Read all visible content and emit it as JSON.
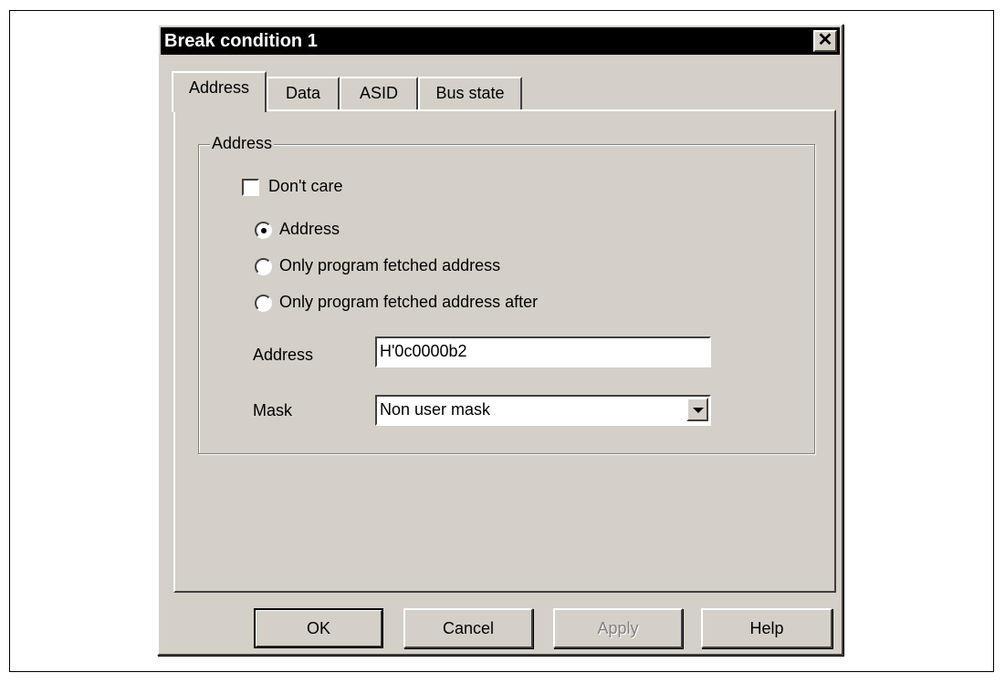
{
  "dialog": {
    "title": "Break condition 1",
    "close_glyph": "✕"
  },
  "tabs": [
    {
      "label": "Address"
    },
    {
      "label": "Data"
    },
    {
      "label": "ASID"
    },
    {
      "label": "Bus state"
    }
  ],
  "address_group": {
    "legend": "Address",
    "dont_care": {
      "label": "Don't care",
      "checked": false
    },
    "radios": [
      {
        "label": "Address",
        "selected": true
      },
      {
        "label": "Only program fetched address",
        "selected": false
      },
      {
        "label": "Only program fetched address after",
        "selected": false
      }
    ],
    "address_field": {
      "label": "Address",
      "value": "H'0c0000b2"
    },
    "mask_field": {
      "label": "Mask",
      "value": "Non user mask"
    }
  },
  "buttons": {
    "ok": "OK",
    "cancel": "Cancel",
    "apply": "Apply",
    "help": "Help"
  },
  "icons": {
    "close": "close-icon",
    "dropdown": "chevron-down-icon"
  }
}
